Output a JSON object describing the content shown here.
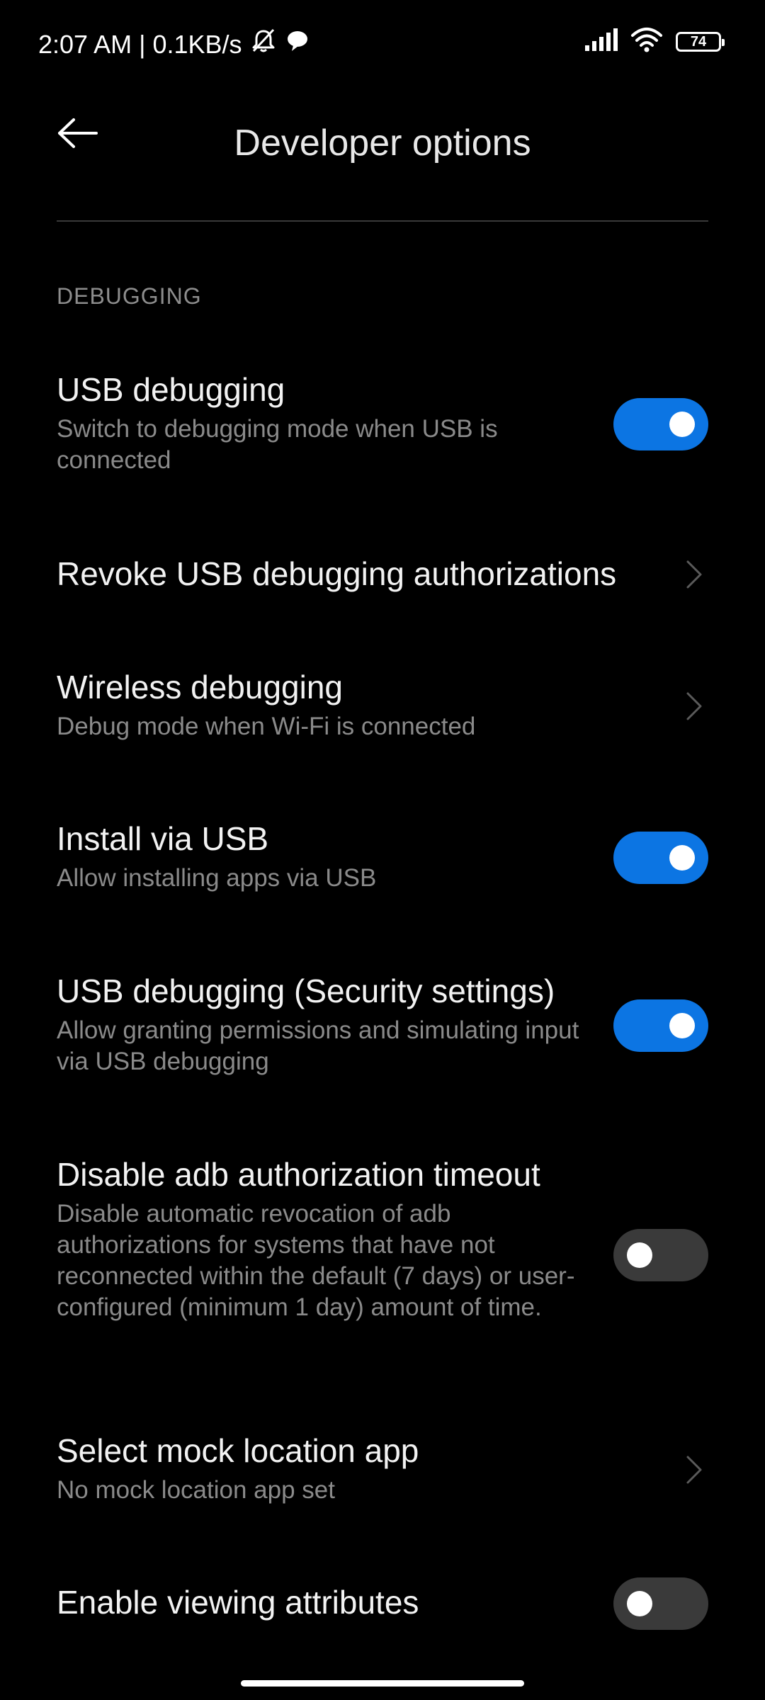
{
  "status_bar": {
    "time_speed": "2:07 AM | 0.1KB/s",
    "battery_level": "74",
    "icons": [
      "muted-bell-icon",
      "message-bubble-icon",
      "signal-icon",
      "wifi-icon",
      "battery-icon"
    ]
  },
  "header": {
    "title": "Developer options",
    "back_icon": "arrow-left-icon"
  },
  "section": {
    "label": "DEBUGGING"
  },
  "items": [
    {
      "title": "USB debugging",
      "summary": "Switch to debugging mode when USB is connected",
      "control": "switch",
      "checked": true
    },
    {
      "title": "Revoke USB debugging authorizations",
      "summary": "",
      "control": "chevron"
    },
    {
      "title": "Wireless debugging",
      "summary": "Debug mode when Wi-Fi is connected",
      "control": "chevron"
    },
    {
      "title": "Install via USB",
      "summary": "Allow installing apps via USB",
      "control": "switch",
      "checked": true
    },
    {
      "title": "USB debugging (Security settings)",
      "summary": "Allow granting permissions and simulating input via USB debugging",
      "control": "switch",
      "checked": true
    },
    {
      "title": "Disable adb authorization timeout",
      "summary": "Disable automatic revocation of adb authorizations for systems that have not reconnected within the default (7 days) or user-configured (minimum 1 day) amount of time.",
      "control": "switch",
      "checked": false
    },
    {
      "title": "Select mock location app",
      "summary": "No mock location app set",
      "control": "chevron"
    },
    {
      "title": "Enable viewing attributes",
      "summary": "",
      "control": "switch",
      "checked": false
    }
  ],
  "colors": {
    "background": "#000000",
    "accent": "#0c75e3",
    "switch_off": "#3a3a3a",
    "secondary_text": "#8a8a8a"
  }
}
